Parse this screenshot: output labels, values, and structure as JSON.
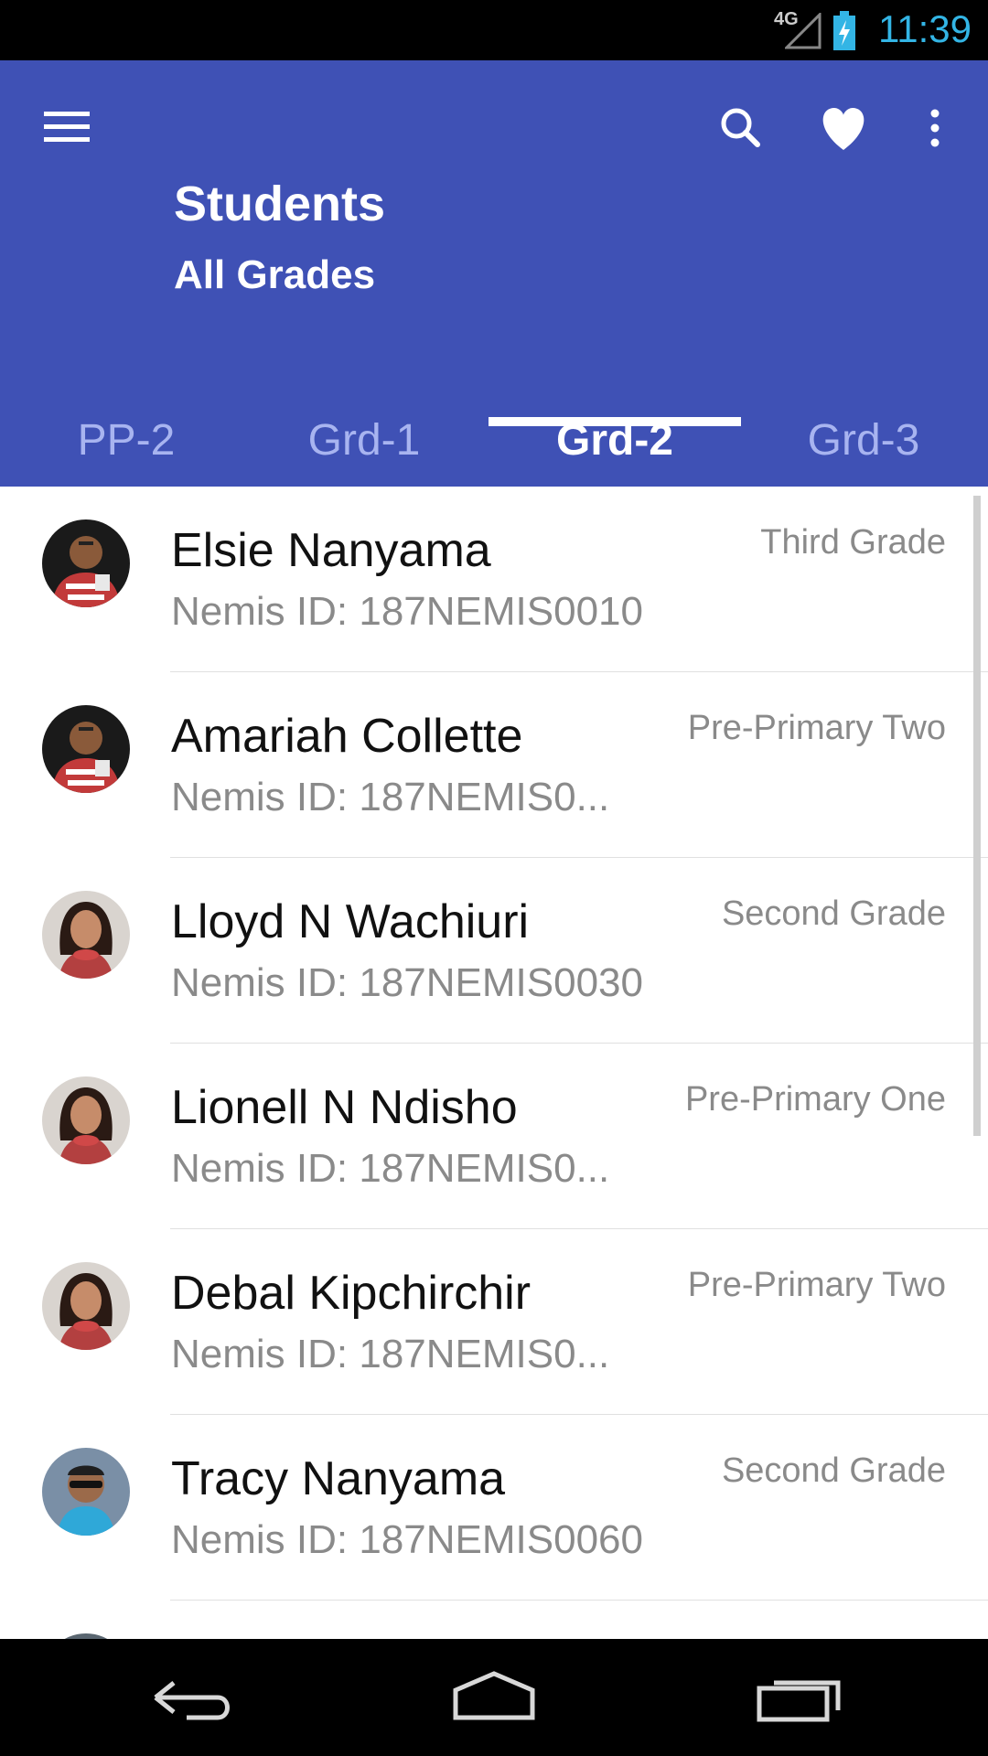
{
  "status": {
    "network": "4G",
    "time": "11:39"
  },
  "appbar": {
    "title": "Students",
    "subtitle": "All Grades"
  },
  "tabs": [
    {
      "label": "PP-2"
    },
    {
      "label": "Grd-1"
    },
    {
      "label": "Grd-2"
    },
    {
      "label": "Grd-3"
    }
  ],
  "active_tab": "Grd-2",
  "students": [
    {
      "name": "Elsie Nanyama",
      "nemis": "Nemis ID: 187NEMIS0010",
      "grade": "Third Grade",
      "avatar": "avatar-man-red-shirt"
    },
    {
      "name": "Amariah Collette",
      "nemis": "Nemis ID: 187NEMIS0...",
      "grade": "Pre-Primary Two",
      "avatar": "avatar-man-red-shirt"
    },
    {
      "name": "Lloyd N Wachiuri",
      "nemis": "Nemis ID: 187NEMIS0030",
      "grade": "Second Grade",
      "avatar": "avatar-woman"
    },
    {
      "name": "Lionell N Ndisho",
      "nemis": "Nemis ID: 187NEMIS0...",
      "grade": "Pre-Primary One",
      "avatar": "avatar-woman"
    },
    {
      "name": "Debal Kipchirchir",
      "nemis": "Nemis ID: 187NEMIS0...",
      "grade": "Pre-Primary Two",
      "avatar": "avatar-woman"
    },
    {
      "name": "Tracy Nanyama",
      "nemis": "Nemis ID: 187NEMIS0060",
      "grade": "Second Grade",
      "avatar": "avatar-man-sunglasses"
    }
  ],
  "icons": {
    "menu": "menu-icon",
    "search": "search-icon",
    "favorite": "heart-icon",
    "more": "more-vert-icon",
    "back": "back-icon",
    "home": "home-icon",
    "recents": "recents-icon"
  },
  "colors": {
    "primary": "#3f51b5",
    "tab_inactive": "#a8b4f0",
    "clock": "#33b5e5"
  }
}
